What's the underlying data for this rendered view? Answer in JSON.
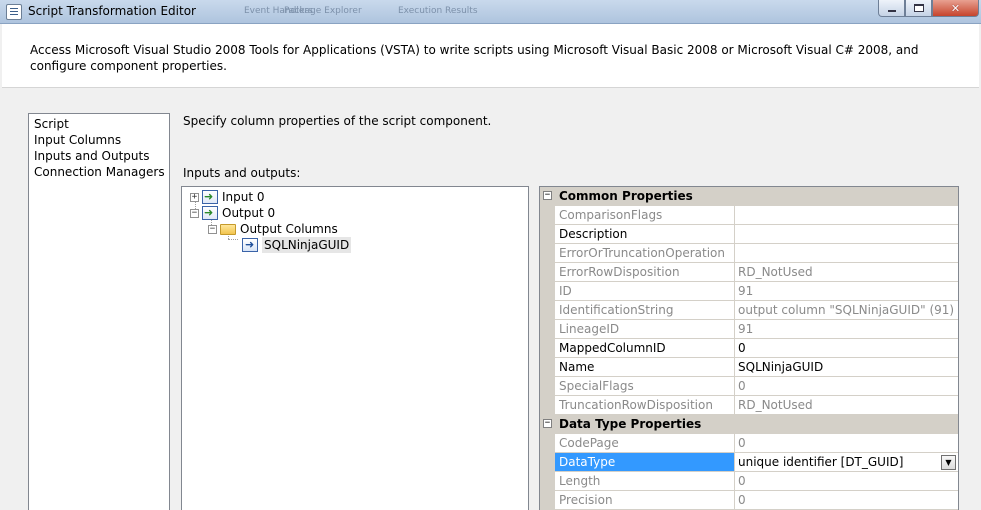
{
  "window": {
    "title": "Script Transformation Editor",
    "background_tabs": [
      "Event Handlers",
      "Package Explorer",
      "Execution Results"
    ]
  },
  "header": {
    "description": "Access Microsoft Visual Studio 2008 Tools for Applications (VSTA) to write scripts using Microsoft Visual Basic 2008 or Microsoft Visual C# 2008, and configure component properties."
  },
  "nav": {
    "items": [
      {
        "label": "Script"
      },
      {
        "label": "Input Columns"
      },
      {
        "label": "Inputs and Outputs",
        "selected": true
      },
      {
        "label": "Connection Managers"
      }
    ]
  },
  "main": {
    "instruction": "Specify column properties of the script component.",
    "io_label": "Inputs and outputs:"
  },
  "tree": {
    "nodes": [
      {
        "label": "Input 0",
        "expander": "+"
      },
      {
        "label": "Output 0",
        "expander": "−"
      },
      {
        "label": "Output Columns",
        "expander": "−"
      },
      {
        "label": "SQLNinjaGUID"
      }
    ]
  },
  "properties": {
    "common_category": "Common Properties",
    "common": [
      {
        "name": "ComparisonFlags",
        "value": "",
        "readonly": true
      },
      {
        "name": "Description",
        "value": "",
        "readonly": false
      },
      {
        "name": "ErrorOrTruncationOperation",
        "value": "",
        "readonly": true
      },
      {
        "name": "ErrorRowDisposition",
        "value": "RD_NotUsed",
        "readonly": true
      },
      {
        "name": "ID",
        "value": "91",
        "readonly": true
      },
      {
        "name": "IdentificationString",
        "value": "output column \"SQLNinjaGUID\" (91)",
        "readonly": true
      },
      {
        "name": "LineageID",
        "value": "91",
        "readonly": true
      },
      {
        "name": "MappedColumnID",
        "value": "0",
        "readonly": false
      },
      {
        "name": "Name",
        "value": "SQLNinjaGUID",
        "readonly": false
      },
      {
        "name": "SpecialFlags",
        "value": "0",
        "readonly": true
      },
      {
        "name": "TruncationRowDisposition",
        "value": "RD_NotUsed",
        "readonly": true
      }
    ],
    "datatype_category": "Data Type Properties",
    "datatype": [
      {
        "name": "CodePage",
        "value": "0",
        "readonly": true
      },
      {
        "name": "DataType",
        "value": "unique identifier [DT_GUID]",
        "readonly": false,
        "selected": true
      },
      {
        "name": "Length",
        "value": "0",
        "readonly": true
      },
      {
        "name": "Precision",
        "value": "0",
        "readonly": true
      }
    ]
  },
  "colors": {
    "selection": "#3399ff",
    "category_bg": "#d4d0c8",
    "readonly_text": "#8a8a8a"
  }
}
